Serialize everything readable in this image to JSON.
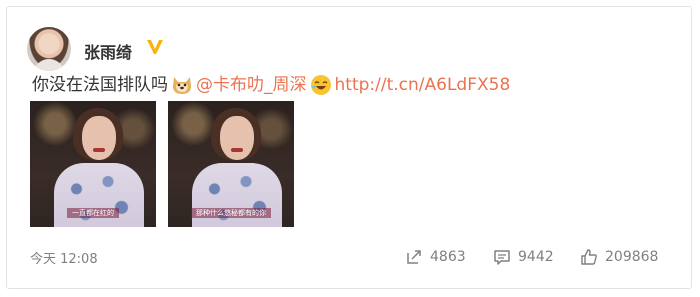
{
  "post": {
    "username": "张雨绮",
    "text_before": "你没在法国排队吗",
    "mention": "@卡布叻_周深",
    "link": "http://t.cn/A6LdFX58",
    "emoji_1": "doge-emoji",
    "emoji_2": "laugh-emoji",
    "images": [
      {
        "caption": "一直都在红的"
      },
      {
        "caption": "那种什么悠秘都有的你"
      }
    ],
    "timestamp": "今天 12:08"
  },
  "actions": {
    "repost_count": "4863",
    "comment_count": "9442",
    "like_count": "209868"
  },
  "colors": {
    "text": "#333333",
    "link": "#eb7350",
    "muted": "#808080",
    "verified": "#f5b50a"
  }
}
